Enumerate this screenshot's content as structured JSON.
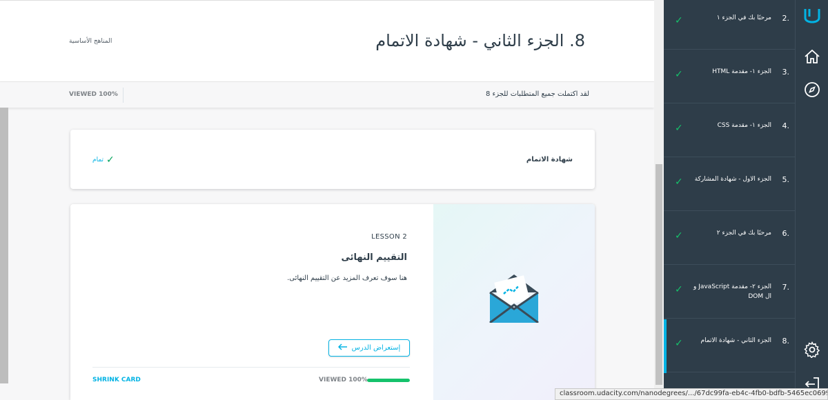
{
  "header": {
    "title": "8. الجزء الثاني - شهادة الاتمام",
    "breadcrumb": "المناهج الأساسية"
  },
  "status": {
    "message": "لقد اكتملت جميع المتطلبات للجزء 8",
    "viewed": "VIEWED 100%"
  },
  "concept_card": {
    "title": "شهادة الاتمام",
    "done_label": "تمام"
  },
  "lesson_card": {
    "label": "LESSON 2",
    "title": "التقييم النهائى",
    "description": "هنا سوف تعرف المزيد عن التقييم النهائى.",
    "review_button": "إستعراض الدرس",
    "shrink": "SHRINK CARD",
    "viewed": "VIEWED 100%",
    "progress": 1.0
  },
  "sidebar": {
    "items": [
      {
        "num": "2.",
        "label": "مرحبًا بك في الجزء ١"
      },
      {
        "num": "3.",
        "label": "الجزء ١- مقدمة HTML"
      },
      {
        "num": "4.",
        "label": "الجزء ١- مقدمة CSS"
      },
      {
        "num": "5.",
        "label": "الجزء الاول - شهادة المشاركة"
      },
      {
        "num": "6.",
        "label": "مرحبًا بك في الجزء ٢"
      },
      {
        "num": "7.",
        "label": "الجزء ٢- مقدمة JavaScript و ال DOM"
      },
      {
        "num": "8.",
        "label": "الجزء الثاني - شهادة الاتمام"
      }
    ]
  },
  "rail": {
    "icons": [
      "udacity-logo-icon",
      "home-icon",
      "compass-icon",
      "gear-icon",
      "logout-icon"
    ]
  },
  "browser": {
    "url": "classroom.udacity.com/nanodegrees/.../67dc99fa-eb4c-4fb0-bdfb-5465ec069963"
  },
  "colors": {
    "accent": "#02b3e4",
    "success": "#15c26b",
    "sidebar": "#2e3d49"
  }
}
